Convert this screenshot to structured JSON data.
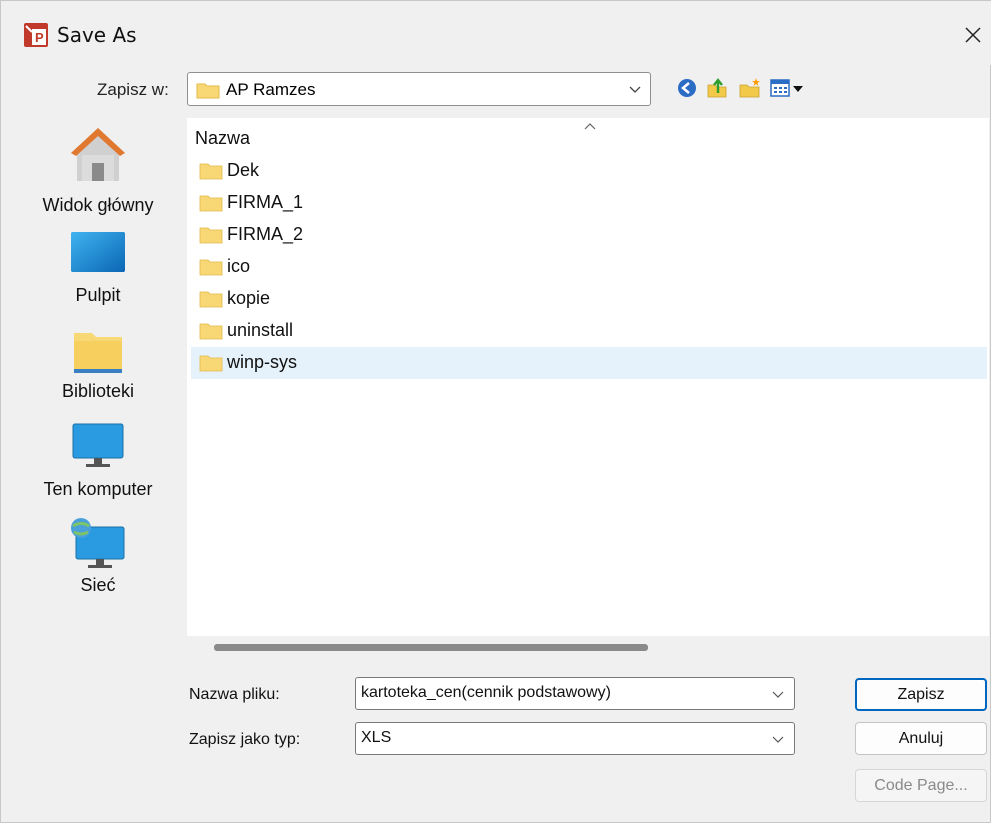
{
  "window": {
    "title": "Save As",
    "close_glyph": "✕"
  },
  "save_in": {
    "label": "Zapisz w:",
    "value": "AP Ramzes"
  },
  "toolbar": {
    "icons": [
      "back-icon",
      "up-folder-icon",
      "new-folder-icon",
      "view-menu-icon"
    ]
  },
  "places": [
    {
      "label": "Widok główny",
      "icon": "home-icon"
    },
    {
      "label": "Pulpit",
      "icon": "desktop-icon"
    },
    {
      "label": "Biblioteki",
      "icon": "libraries-icon"
    },
    {
      "label": "Ten komputer",
      "icon": "computer-icon"
    },
    {
      "label": "Sieć",
      "icon": "network-icon"
    }
  ],
  "file_list": {
    "column_header": "Nazwa",
    "items": [
      {
        "name": "Dek"
      },
      {
        "name": "FIRMA_1"
      },
      {
        "name": "FIRMA_2"
      },
      {
        "name": "ico"
      },
      {
        "name": "kopie"
      },
      {
        "name": "uninstall"
      },
      {
        "name": "winp-sys",
        "selected": true
      }
    ]
  },
  "filename": {
    "label": "Nazwa pliku:",
    "value": "kartoteka_cen(cennik podstawowy)"
  },
  "filetype": {
    "label": "Zapisz jako typ:",
    "value": "XLS"
  },
  "buttons": {
    "save": "Zapisz",
    "cancel": "Anuluj",
    "code_page": "Code Page..."
  },
  "colors": {
    "accent": "#0067c0",
    "selection": "#e5f1fb",
    "folder": "#f8d775"
  }
}
